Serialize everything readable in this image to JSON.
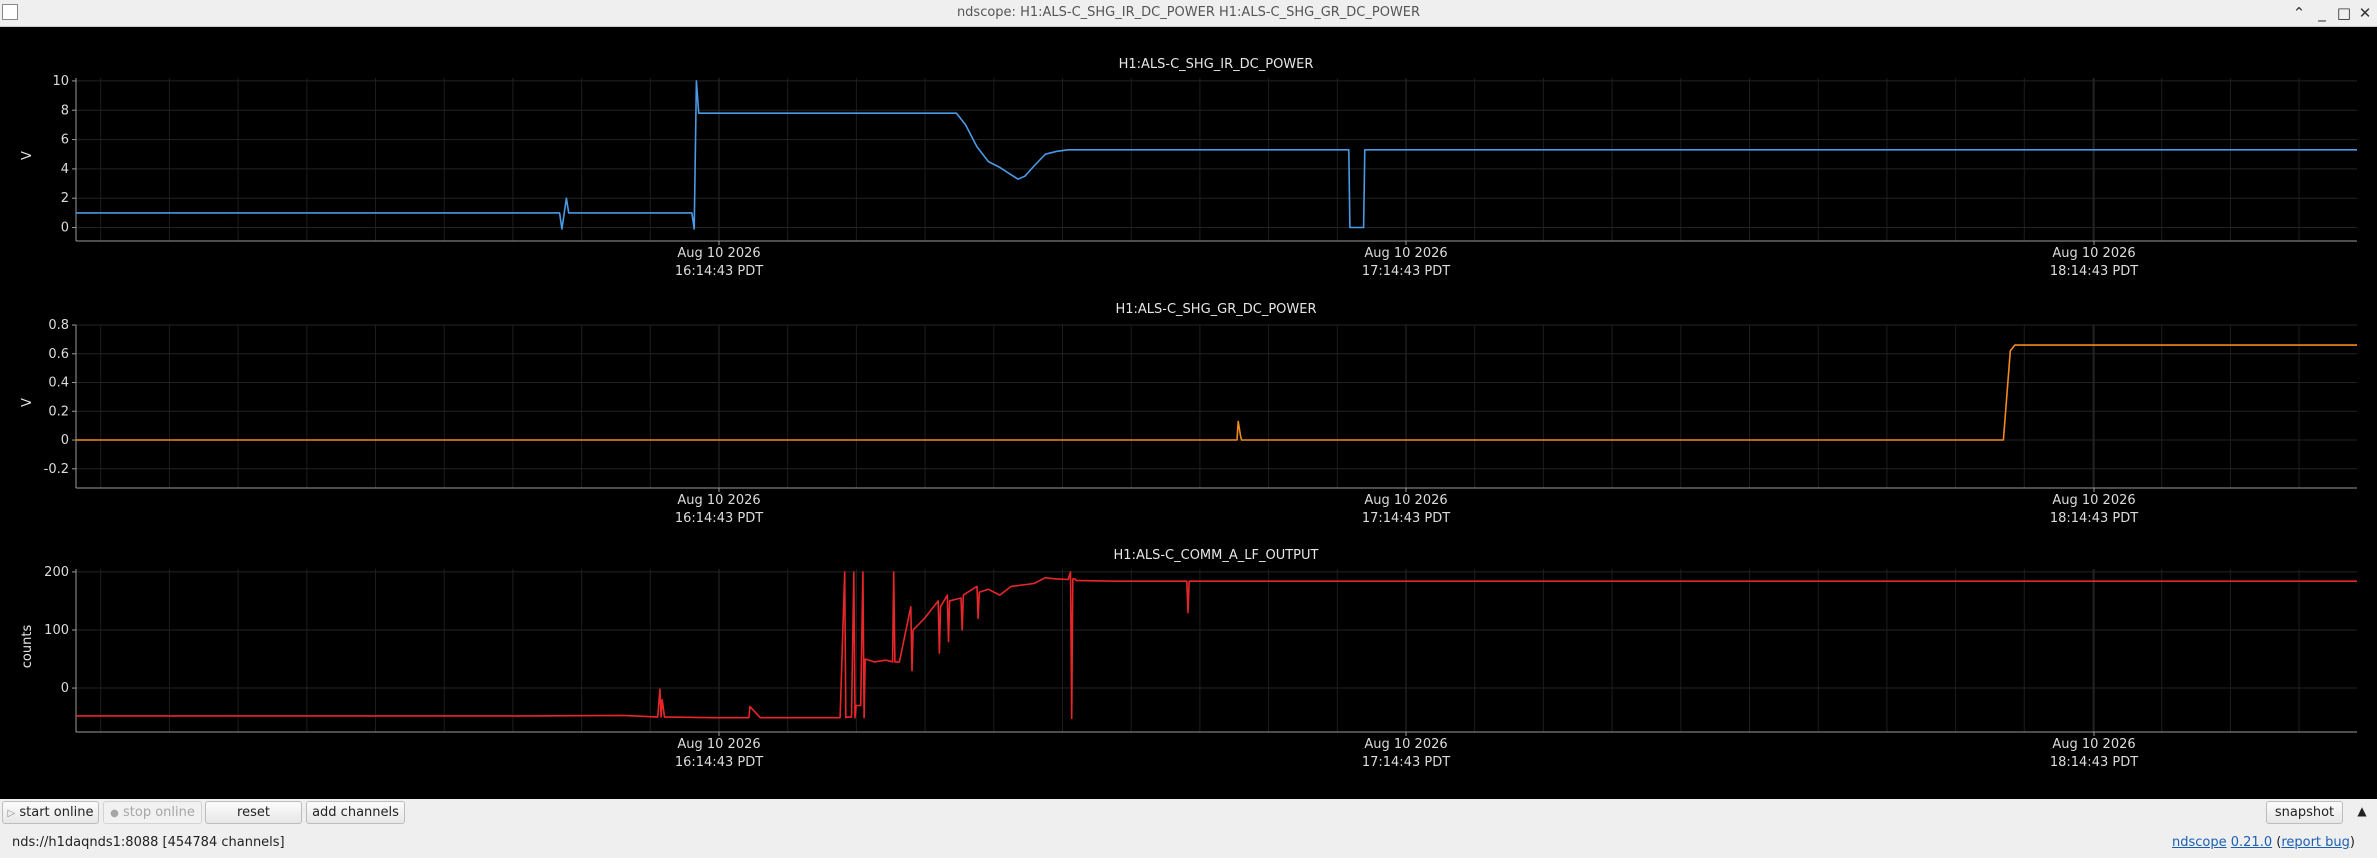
{
  "window": {
    "title": "ndscope: H1:ALS-C_SHG_IR_DC_POWER H1:ALS-C_SHG_GR_DC_POWER"
  },
  "plots": [
    {
      "title": "H1:ALS-C_SHG_IR_DC_POWER",
      "ylabel": "V",
      "color": "#4a9ae6",
      "yticks": [
        "10",
        "8",
        "6",
        "4",
        "2",
        "0"
      ],
      "ytick_values": [
        10,
        8,
        6,
        4,
        2,
        0
      ],
      "ylim": [
        -0.1,
        10.2
      ],
      "xticks": [
        {
          "date": "Aug 10 2026",
          "time": "16:14:43 PDT"
        },
        {
          "date": "Aug 10 2026",
          "time": "17:14:43 PDT"
        },
        {
          "date": "Aug 10 2026",
          "time": "18:14:43 PDT"
        }
      ]
    },
    {
      "title": "H1:ALS-C_SHG_GR_DC_POWER",
      "ylabel": "V",
      "color": "#f28a1e",
      "yticks": [
        "0.8",
        "0.6",
        "0.4",
        "0.2",
        "0",
        "-0.2"
      ],
      "ytick_values": [
        0.8,
        0.6,
        0.4,
        0.2,
        0,
        -0.2
      ],
      "ylim": [
        -0.25,
        0.8
      ],
      "xticks": [
        {
          "date": "Aug 10 2026",
          "time": "16:14:43 PDT"
        },
        {
          "date": "Aug 10 2026",
          "time": "17:14:43 PDT"
        },
        {
          "date": "Aug 10 2026",
          "time": "18:14:43 PDT"
        }
      ]
    },
    {
      "title": "H1:ALS-C_COMM_A_LF_OUTPUT",
      "ylabel": "counts",
      "color": "#e8262a",
      "yticks": [
        "200",
        "100",
        "0"
      ],
      "ytick_values": [
        200,
        100,
        0
      ],
      "ylim": [
        -55,
        205
      ],
      "xticks": [
        {
          "date": "Aug 10 2026",
          "time": "16:14:43 PDT"
        },
        {
          "date": "Aug 10 2026",
          "time": "17:14:43 PDT"
        },
        {
          "date": "Aug 10 2026",
          "time": "18:14:43 PDT"
        }
      ]
    }
  ],
  "toolbar": {
    "start_online": "start online",
    "stop_online": "stop online",
    "reset": "reset",
    "add_channels": "add channels",
    "snapshot": "snapshot"
  },
  "status": {
    "nds": "nds://h1daqnds1:8088  [454784 channels]",
    "app_name": "ndscope",
    "version": "0.21.0",
    "report_bug": "report bug"
  },
  "chart_data": [
    {
      "type": "line",
      "title": "H1:ALS-C_SHG_IR_DC_POWER",
      "ylabel": "V",
      "ylim": [
        -0.1,
        10.2
      ],
      "series": [
        {
          "x": [
            0,
            0.212,
            0.213,
            0.215,
            0.216,
            0.27,
            0.271,
            0.272,
            0.273,
            0.275,
            0.386,
            0.39,
            0.395,
            0.4,
            0.405,
            0.41,
            0.413,
            0.416,
            0.42,
            0.425,
            0.43,
            0.435,
            0.44,
            0.495,
            0.558,
            0.5585,
            0.5645,
            0.565,
            1.0
          ],
          "y": [
            1.0,
            1.0,
            -0.1,
            2.0,
            1.0,
            1.0,
            -0.1,
            10.0,
            7.8,
            7.8,
            7.8,
            7.0,
            5.5,
            4.5,
            4.1,
            3.6,
            3.3,
            3.5,
            4.2,
            5.0,
            5.2,
            5.3,
            5.3,
            5.3,
            5.3,
            0.0,
            0.0,
            5.3,
            5.3
          ]
        }
      ]
    },
    {
      "type": "line",
      "title": "H1:ALS-C_SHG_GR_DC_POWER",
      "ylabel": "V",
      "ylim": [
        -0.25,
        0.8
      ],
      "series": [
        {
          "x": [
            0,
            0.509,
            0.5095,
            0.5105,
            0.511,
            0.845,
            0.848,
            0.85,
            1.0
          ],
          "y": [
            0,
            0,
            0.13,
            0.03,
            0,
            0,
            0.62,
            0.66,
            0.66
          ]
        }
      ]
    },
    {
      "type": "line",
      "title": "H1:ALS-C_COMM_A_LF_OUTPUT",
      "ylabel": "counts",
      "ylim": [
        -55,
        205
      ],
      "series": [
        {
          "x": [
            0,
            0.2,
            0.24,
            0.255,
            0.256,
            0.2565,
            0.257,
            0.258,
            0.26,
            0.28,
            0.295,
            0.2955,
            0.3,
            0.335,
            0.337,
            0.3375,
            0.338,
            0.34,
            0.341,
            0.3415,
            0.342,
            0.344,
            0.345,
            0.3455,
            0.346,
            0.35,
            0.355,
            0.358,
            0.3585,
            0.359,
            0.361,
            0.366,
            0.3665,
            0.367,
            0.372,
            0.378,
            0.3785,
            0.379,
            0.382,
            0.3825,
            0.383,
            0.388,
            0.3885,
            0.389,
            0.395,
            0.3955,
            0.396,
            0.4,
            0.405,
            0.41,
            0.42,
            0.425,
            0.427,
            0.43,
            0.435,
            0.436,
            0.4365,
            0.437,
            0.438,
            0.4385,
            0.439,
            0.44,
            0.455,
            0.48,
            0.487,
            0.4875,
            0.488,
            0.49,
            1.0
          ],
          "y": [
            -48,
            -48,
            -47,
            -50,
            -2,
            -50,
            -20,
            -50,
            -50,
            -51,
            -51,
            -32,
            -51,
            -51,
            200,
            -51,
            -50,
            -50,
            200,
            -51,
            -30,
            -30,
            200,
            -51,
            50,
            45,
            48,
            45,
            200,
            45,
            45,
            140,
            30,
            100,
            120,
            150,
            60,
            140,
            160,
            80,
            150,
            155,
            100,
            160,
            175,
            120,
            165,
            170,
            160,
            175,
            180,
            190,
            189,
            188,
            187,
            200,
            -52,
            188,
            188,
            185,
            185,
            185,
            184,
            184,
            184,
            130,
            184,
            184,
            184
          ]
        }
      ]
    }
  ]
}
